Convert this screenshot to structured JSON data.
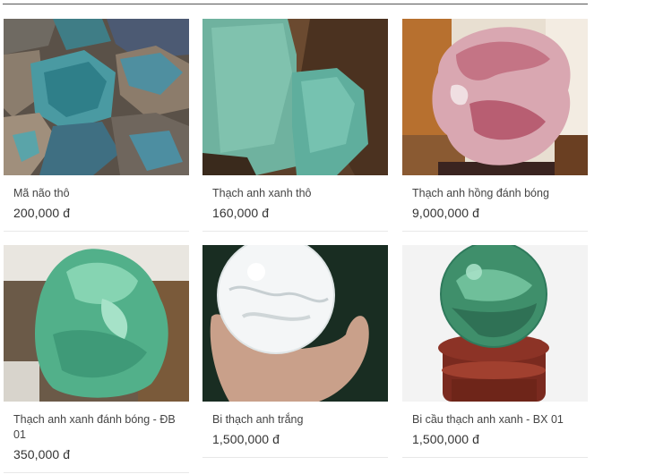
{
  "products": [
    {
      "name": "Mã não thô",
      "price": "200,000 đ"
    },
    {
      "name": "Thạch anh xanh thô",
      "price": "160,000 đ"
    },
    {
      "name": "Thạch anh hồng đánh bóng",
      "price": "9,000,000 đ"
    },
    {
      "name": "Thạch anh xanh đánh bóng - ĐB 01",
      "price": "350,000 đ"
    },
    {
      "name": "Bi thạch anh trắng",
      "price": "1,500,000 đ"
    },
    {
      "name": "Bi cầu thạch anh xanh - BX 01",
      "price": "1,500,000 đ"
    }
  ]
}
